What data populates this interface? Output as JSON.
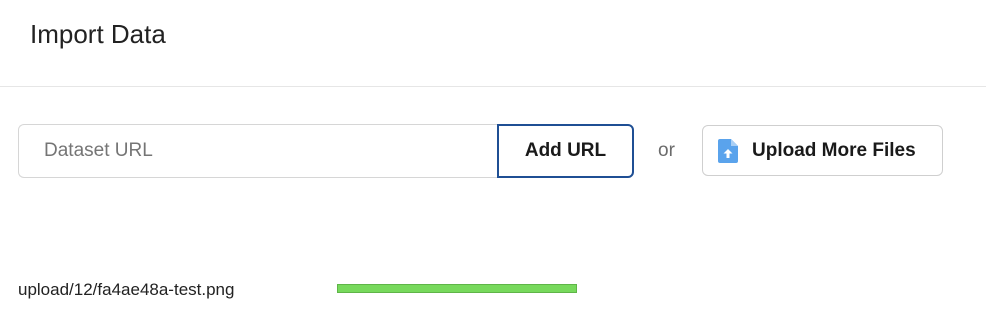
{
  "header": {
    "title": "Import Data"
  },
  "url_form": {
    "input_value": "",
    "input_placeholder": "Dataset URL",
    "add_button_label": "Add URL"
  },
  "separator_text": "or",
  "upload": {
    "button_label": "Upload More Files",
    "icon": "file-upload-icon"
  },
  "uploads": [
    {
      "path": "upload/12/fa4ae48a-test.png",
      "progress": 1.0
    }
  ],
  "colors": {
    "accent_border": "#1f4f94",
    "progress_fill": "#77d95c",
    "icon_blue": "#5aa3ec"
  }
}
